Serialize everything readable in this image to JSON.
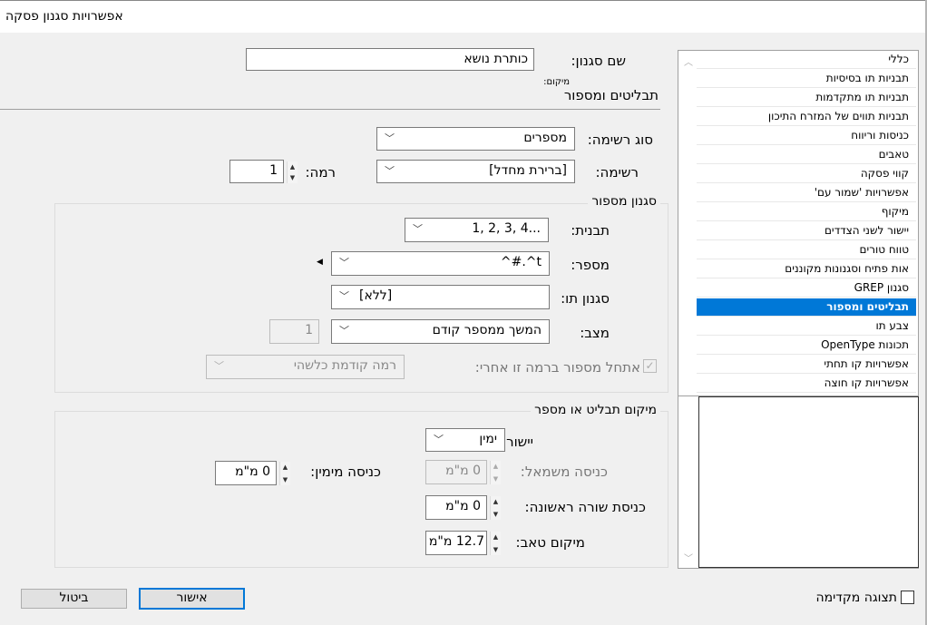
{
  "window": {
    "title": "אפשרויות סגנון פסקה"
  },
  "sidebar": {
    "items": [
      "כללי",
      "תבניות תו בסיסיות",
      "תבניות תו מתקדמות",
      "תבניות תווים של המזרח התיכון",
      "כניסות וריווח",
      "טאבים",
      "קווי פסקה",
      "אפשרויות 'שמור עם'",
      "מיקוף",
      "יישור לשני הצדדים",
      "טווח טורים",
      "אות פתיח וסגנונות מקוננים",
      "סגנון GREP",
      "תבליטים ומספור",
      "צבע תו",
      "תכונות OpenType",
      "אפשרויות קו תחתי",
      "אפשרויות קו חוצה"
    ],
    "selected_index": 13
  },
  "style_name": {
    "label": "שם סגנון:",
    "value": "כותרת נושא",
    "location_label": "מיקום:"
  },
  "section_title": "תבליטים ומספור",
  "list_type": {
    "label": "סוג רשימה:",
    "value": "מספרים"
  },
  "list": {
    "label": "רשימה:",
    "value": "[ברירת מחדל]"
  },
  "level": {
    "label": "רמה:",
    "value": "1"
  },
  "numbering_style": {
    "title": "סגנון מספור",
    "format": {
      "label": "תבנית:",
      "value": "1, 2, 3, 4..."
    },
    "number": {
      "label": "מספר:",
      "value": "^#.^t"
    },
    "char_style": {
      "label": "סגנון תו:",
      "value": "[ללא]"
    },
    "mode": {
      "label": "מצב:",
      "value": "המשך ממספר קודם",
      "start_value": "1"
    },
    "restart": {
      "label": "אתחל מספור ברמה זו אחרי:",
      "value": "רמה קודמת כלשהי",
      "checked": true
    }
  },
  "position": {
    "title": "מיקום תבליט או מספר",
    "alignment": {
      "label": "יישור:",
      "value": "ימין"
    },
    "left_indent": {
      "label": "כניסה משמאל:",
      "value": "0 מ\"מ"
    },
    "right_indent": {
      "label": "כניסה מימין:",
      "value": "0 מ\"מ"
    },
    "first_line_indent": {
      "label": "כניסת שורה ראשונה:",
      "value": "0 מ\"מ"
    },
    "tab_position": {
      "label": "מיקום טאב:",
      "value": "12.7 מ\"מ"
    }
  },
  "footer": {
    "preview_label": "תצוגה מקדימה",
    "preview_checked": false,
    "ok_label": "אישור",
    "cancel_label": "ביטול"
  },
  "colors": {
    "accent": "#0078d7"
  }
}
